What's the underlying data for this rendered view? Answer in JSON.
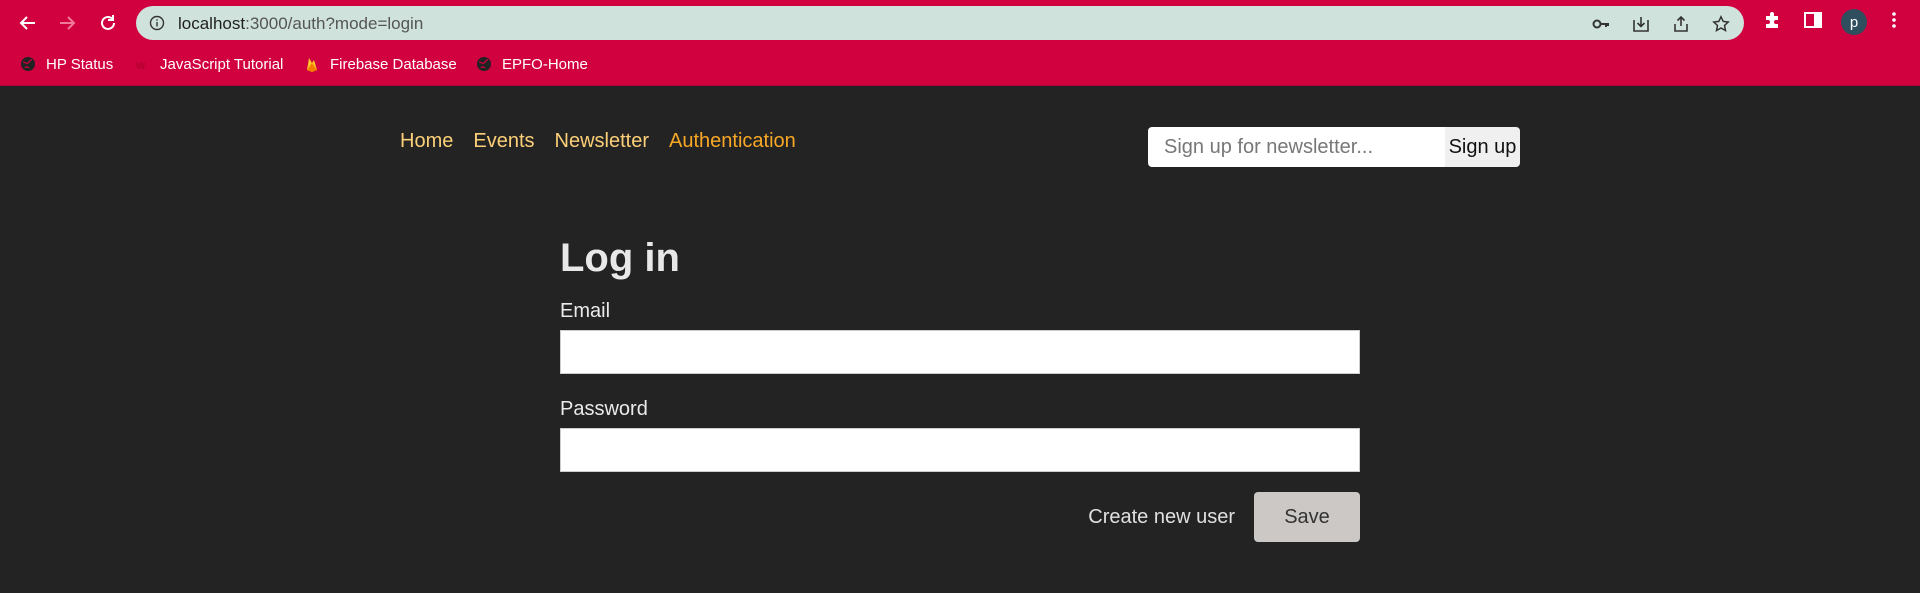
{
  "browser": {
    "url_host": "localhost",
    "url_path": ":3000/auth?mode=login",
    "avatar_letter": "p",
    "bookmarks": [
      {
        "label": "HP Status",
        "icon": "globe-icon"
      },
      {
        "label": "JavaScript Tutorial",
        "icon": "w3schools-icon"
      },
      {
        "label": "Firebase Database",
        "icon": "firebase-icon"
      },
      {
        "label": "EPFO-Home",
        "icon": "globe-icon"
      }
    ],
    "colors": {
      "accent": "#d1003f",
      "omnibox": "#cfe3dc"
    }
  },
  "nav": {
    "items": [
      "Home",
      "Events",
      "Newsletter",
      "Authentication"
    ],
    "active": "Authentication"
  },
  "newsletter": {
    "placeholder": "Sign up for newsletter...",
    "button": "Sign up"
  },
  "form": {
    "title": "Log in",
    "email_label": "Email",
    "email_value": "",
    "password_label": "Password",
    "password_value": "",
    "create_link": "Create new user",
    "save_button": "Save"
  }
}
